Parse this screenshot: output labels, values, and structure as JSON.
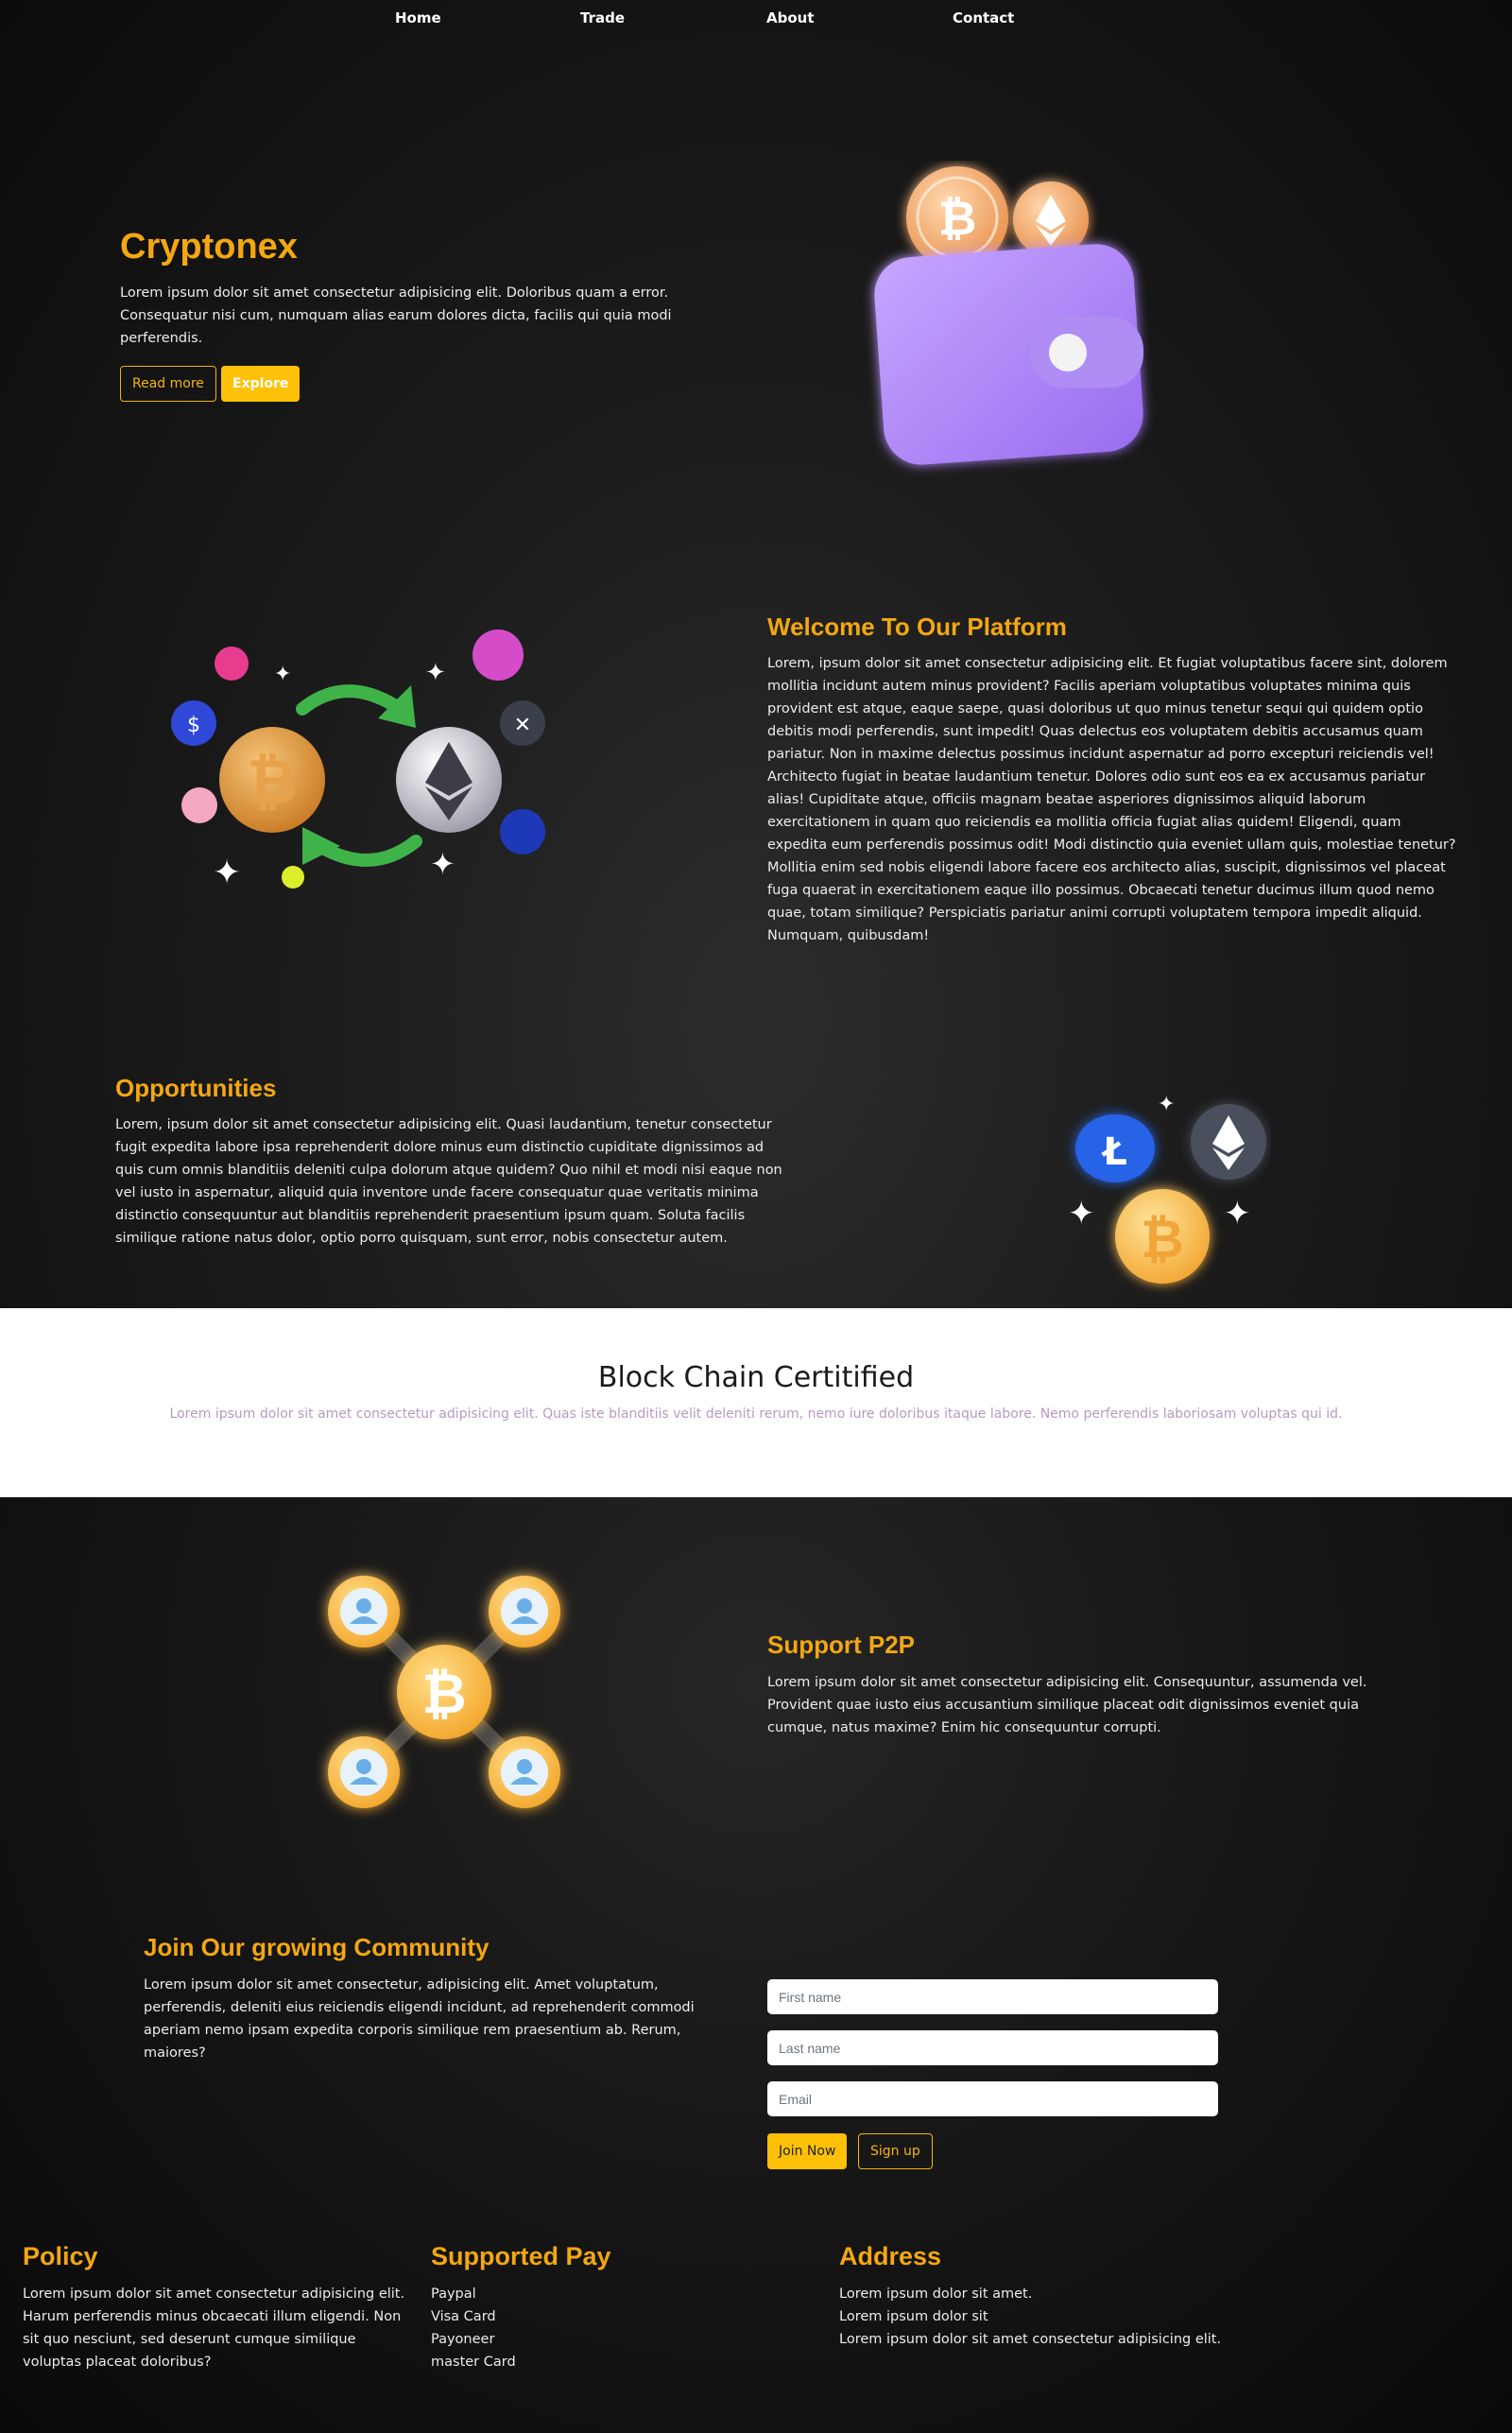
{
  "nav": {
    "home": "Home",
    "trade": "Trade",
    "about": "About",
    "contact": "Contact"
  },
  "hero": {
    "title": "Cryptonex",
    "text": "Lorem ipsum dolor sit amet consectetur adipisicing elit. Doloribus quam a error. Consequatur nisi cum, numquam alias earum dolores dicta, facilis qui quia modi perferendis.",
    "read_more": "Read more",
    "explore": "Explore",
    "image_icon": "wallet-icon"
  },
  "welcome": {
    "title": "Welcome To Our Platform",
    "text": "Lorem, ipsum dolor sit amet consectetur adipisicing elit. Et fugiat voluptatibus facere sint, dolorem mollitia incidunt autem minus provident? Facilis aperiam voluptatibus voluptates minima quis provident est atque, eaque saepe, quasi doloribus ut quo minus tenetur sequi qui quidem optio debitis modi perferendis, sunt impedit! Quas delectus eos voluptatem debitis accusamus quam pariatur. Non in maxime delectus possimus incidunt aspernatur ad porro excepturi reiciendis vel! Architecto fugiat in beatae laudantium tenetur. Dolores odio sunt eos ea ex accusamus pariatur alias! Cupiditate atque, officiis magnam beatae asperiores dignissimos aliquid laborum exercitationem in quam quo reiciendis ea mollitia officia fugiat alias quidem! Eligendi, quam expedita eum perferendis possimus odit! Modi distinctio quia eveniet ullam quis, molestiae tenetur? Mollitia enim sed nobis eligendi labore facere eos architecto alias, suscipit, dignissimos vel placeat fuga quaerat in exercitationem eaque illo possimus. Obcaecati tenetur ducimus illum quod nemo quae, totam similique? Perspiciatis pariatur animi corrupti voluptatem tempora impedit aliquid. Numquam, quibusdam!",
    "image_icon": "crypto-exchange-icon"
  },
  "opportunities": {
    "title": "Opportunities",
    "text": "Lorem, ipsum dolor sit amet consectetur adipisicing elit. Quasi laudantium, tenetur consectetur fugit expedita labore ipsa reprehenderit dolore minus eum distinctio cupiditate dignissimos ad quis cum omnis blanditiis deleniti culpa dolorum atque quidem? Quo nihil et modi nisi eaque non vel iusto in aspernatur, aliquid quia inventore unde facere consequatur quae veritatis minima distinctio consequuntur aut blanditiis reprehenderit praesentium ipsum quam. Soluta facilis similique ratione natus dolor, optio porro quisquam, sunt error, nobis consectetur autem.",
    "image_icon": "coins-icon"
  },
  "certified": {
    "title": "Block Chain Certitified",
    "text": "Lorem ipsum dolor sit amet consectetur adipisicing elit. Quas iste blanditiis velit deleniti rerum, nemo iure doloribus itaque labore. Nemo perferendis laboriosam voluptas qui id."
  },
  "p2p": {
    "title": "Support P2P",
    "text": "Lorem ipsum dolor sit amet consectetur adipisicing elit. Consequuntur, assumenda vel. Provident quae iusto eius accusantium similique placeat odit dignissimos eveniet quia cumque, natus maxime? Enim hic consequuntur corrupti.",
    "image_icon": "p2p-network-icon"
  },
  "community": {
    "title": "Join Our growing Community",
    "text": "Lorem ipsum dolor sit amet consectetur, adipisicing elit. Amet voluptatum, perferendis, deleniti eius reiciendis eligendi incidunt, ad reprehenderit commodi aperiam nemo ipsam expedita corporis similique rem praesentium ab. Rerum, maiores?",
    "first_name_placeholder": "First name",
    "last_name_placeholder": "Last name",
    "email_placeholder": "Email",
    "join_label": "Join Now",
    "signup_label": "Sign up"
  },
  "footer": {
    "policy": {
      "title": "Policy",
      "text": "Lorem ipsum dolor sit amet consectetur adipisicing elit. Harum perferendis minus obcaecati illum eligendi. Non sit quo nesciunt, sed deserunt cumque similique voluptas placeat doloribus?"
    },
    "pay": {
      "title": "Supported Pay",
      "items": [
        "Paypal",
        "Visa Card",
        "Payoneer",
        "master Card"
      ]
    },
    "address": {
      "title": "Address",
      "lines": [
        "Lorem ipsum dolor sit amet.",
        "Lorem ipsum dolor sit",
        "Lorem ipsum dolor sit amet consectetur adipisicing elit."
      ]
    }
  },
  "colors": {
    "accent": "#f3a712",
    "button": "#ffc107",
    "background": "#141414"
  }
}
